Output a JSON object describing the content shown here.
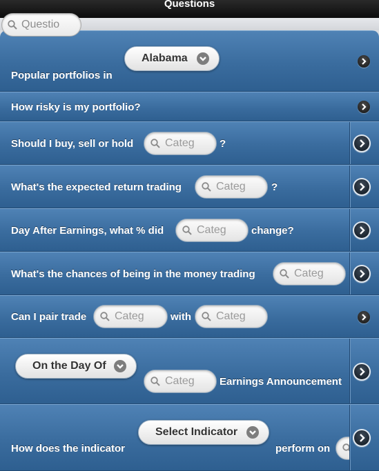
{
  "header": {
    "title": "Questions"
  },
  "search": {
    "placeholder": "Questio"
  },
  "rows": [
    {
      "label": "Popular portfolios in",
      "select": "Alabama"
    },
    {
      "label": "How risky is my portfolio?"
    },
    {
      "label": "Should I buy, sell or hold",
      "field": "Categ",
      "suffix": "?"
    },
    {
      "label": "What's the expected return trading",
      "field": "Categ",
      "suffix": "?"
    },
    {
      "label": "Day After Earnings, what % did",
      "field": "Categ",
      "suffix": "change?"
    },
    {
      "label": "What's the chances of being in the money trading",
      "field": "Categ"
    },
    {
      "label": "Can I pair trade",
      "field1": "Categ",
      "middle": "with",
      "field2": "Categ"
    },
    {
      "select": "On the Day Of",
      "field": "Categ",
      "suffix": "Earnings Announcement"
    },
    {
      "label": "How does the indicator",
      "select": "Select Indicator",
      "suffix": "perform on"
    }
  ],
  "icons": {
    "row_arrow": "chevron-right-circle-icon",
    "select_chevron": "chevron-down-icon",
    "search": "magnifier-icon"
  }
}
